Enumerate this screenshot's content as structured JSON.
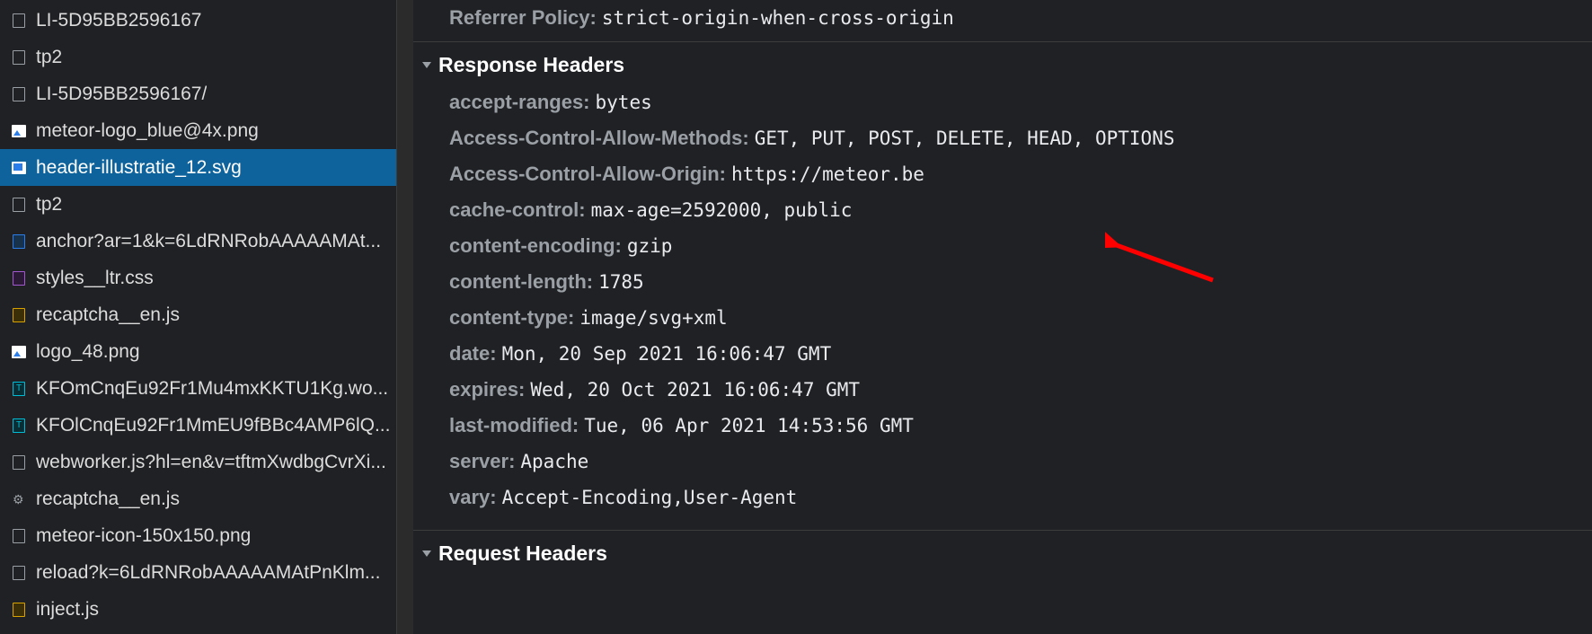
{
  "sidebar": {
    "items": [
      {
        "label": "LI-5D95BB2596167",
        "iconType": "doc",
        "selected": false
      },
      {
        "label": "tp2",
        "iconType": "doc",
        "selected": false
      },
      {
        "label": "LI-5D95BB2596167/",
        "iconType": "doc",
        "selected": false
      },
      {
        "label": "meteor-logo_blue@4x.png",
        "iconType": "img",
        "selected": false
      },
      {
        "label": "header-illustratie_12.svg",
        "iconType": "svg",
        "selected": true
      },
      {
        "label": "tp2",
        "iconType": "doc",
        "selected": false
      },
      {
        "label": "anchor?ar=1&k=6LdRNRobAAAAAMAt...",
        "iconType": "anchor",
        "selected": false
      },
      {
        "label": "styles__ltr.css",
        "iconType": "css",
        "selected": false
      },
      {
        "label": "recaptcha__en.js",
        "iconType": "js",
        "selected": false
      },
      {
        "label": "logo_48.png",
        "iconType": "img",
        "selected": false
      },
      {
        "label": "KFOmCnqEu92Fr1Mu4mxKKTU1Kg.wo...",
        "iconType": "font",
        "selected": false
      },
      {
        "label": "KFOlCnqEu92Fr1MmEU9fBBc4AMP6lQ...",
        "iconType": "font",
        "selected": false
      },
      {
        "label": "webworker.js?hl=en&v=tftmXwdbgCvrXi...",
        "iconType": "doc",
        "selected": false
      },
      {
        "label": "recaptcha__en.js",
        "iconType": "gear",
        "selected": false
      },
      {
        "label": "meteor-icon-150x150.png",
        "iconType": "doc",
        "selected": false
      },
      {
        "label": "reload?k=6LdRNRobAAAAAMAtPnKlm...",
        "iconType": "doc",
        "selected": false
      },
      {
        "label": "inject.js",
        "iconType": "js",
        "selected": false
      }
    ]
  },
  "general": {
    "referrerPolicy": {
      "key": "Referrer Policy:",
      "value": "strict-origin-when-cross-origin"
    }
  },
  "responseHeaders": {
    "title": "Response Headers",
    "items": [
      {
        "key": "accept-ranges:",
        "value": "bytes"
      },
      {
        "key": "Access-Control-Allow-Methods:",
        "value": "GET, PUT, POST, DELETE, HEAD, OPTIONS"
      },
      {
        "key": "Access-Control-Allow-Origin:",
        "value": "https://meteor.be"
      },
      {
        "key": "cache-control:",
        "value": "max-age=2592000, public"
      },
      {
        "key": "content-encoding:",
        "value": "gzip"
      },
      {
        "key": "content-length:",
        "value": "1785"
      },
      {
        "key": "content-type:",
        "value": "image/svg+xml"
      },
      {
        "key": "date:",
        "value": "Mon, 20 Sep 2021 16:06:47 GMT"
      },
      {
        "key": "expires:",
        "value": "Wed, 20 Oct 2021 16:06:47 GMT"
      },
      {
        "key": "last-modified:",
        "value": "Tue, 06 Apr 2021 14:53:56 GMT"
      },
      {
        "key": "server:",
        "value": "Apache"
      },
      {
        "key": "vary:",
        "value": "Accept-Encoding,User-Agent"
      }
    ]
  },
  "requestHeaders": {
    "title": "Request Headers"
  }
}
